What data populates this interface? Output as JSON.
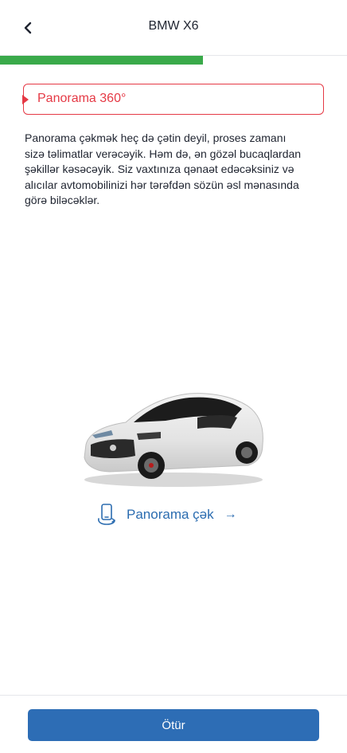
{
  "header": {
    "title": "BMW X6",
    "back_icon": "chevron-left-icon"
  },
  "progress": {
    "fraction": 0.586,
    "color": "#3aaa4a"
  },
  "banner": {
    "label": "Panorama 360°",
    "color": "#e53945"
  },
  "description": "Panorama çəkmək heç də çətin deyil, proses zamanı sizə təlimatlar verəcəyik. Həm də, ən gözəl bucaqlardan şəkillər kəsəcəyik. Siz vaxtınıza qənaət edəcəksiniz və alıcılar avtomobilinizi hər tərəfdən sözün əsl mənasında görə biləcəklər.",
  "car_image": {
    "icon": "car-image"
  },
  "panorama_action": {
    "label": "Panorama çək",
    "arrow": "→",
    "icon": "phone-rotate-icon",
    "color": "#2b6cb0"
  },
  "footer": {
    "submit_label": "Ötür",
    "color": "#2d6db5"
  }
}
